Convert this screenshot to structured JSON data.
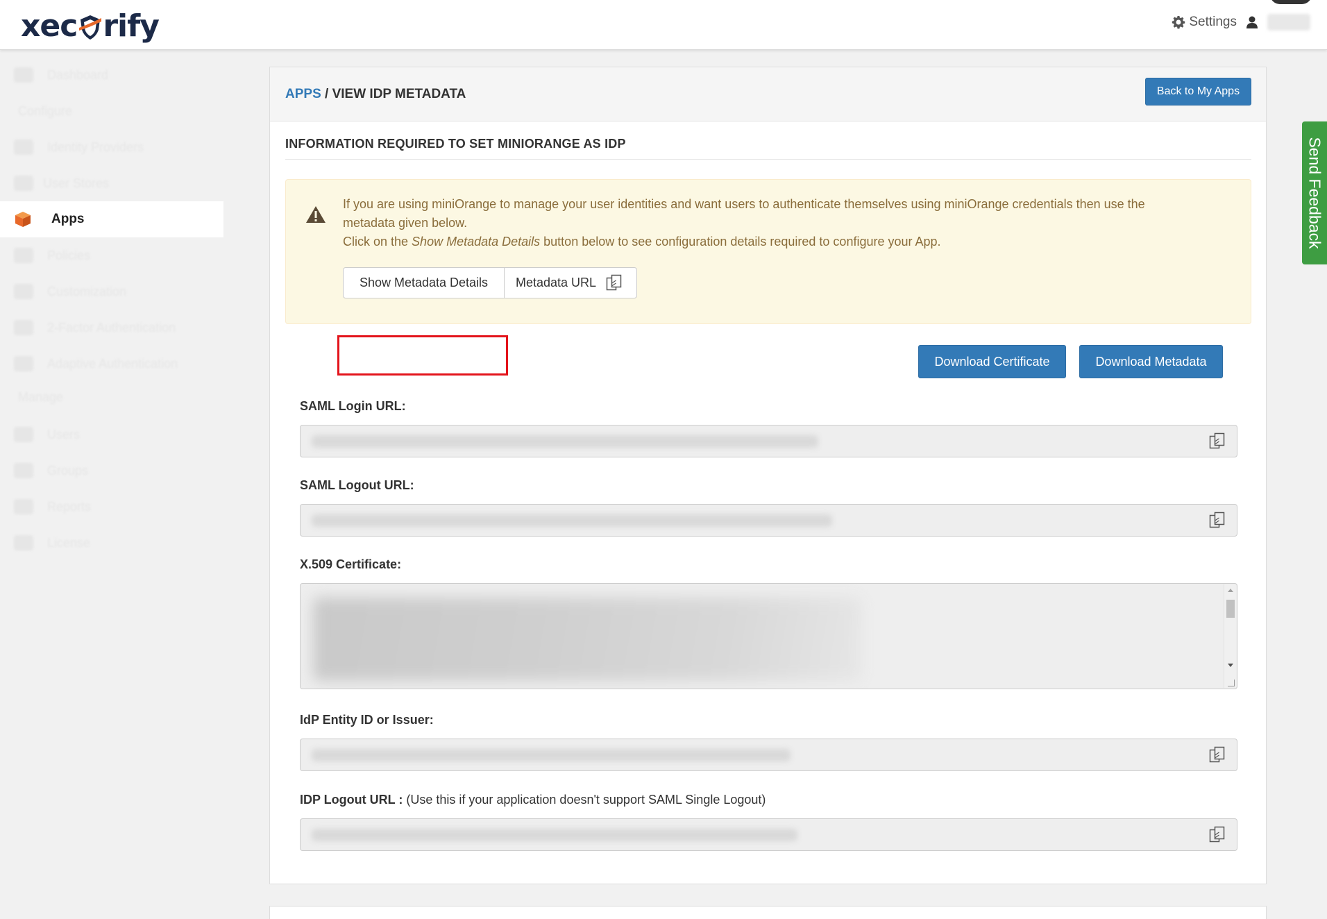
{
  "brand": {
    "logo_left": "xec",
    "logo_right": "rify"
  },
  "header": {
    "settings_label": "Settings",
    "icons": [
      "gear-icon",
      "user-icon"
    ]
  },
  "sidebar": {
    "items": [
      {
        "label": "Dashboard",
        "icon": "dashboard-icon"
      },
      {
        "label": "Configure",
        "section": true
      },
      {
        "label": "Identity Providers",
        "icon": "exchange-icon"
      },
      {
        "label": "User Stores",
        "icon": "database-icon"
      },
      {
        "label": "Apps",
        "icon": "cube-icon",
        "active": true
      },
      {
        "label": "Policies",
        "icon": "document-icon"
      },
      {
        "label": "Customization",
        "icon": "wrench-icon"
      },
      {
        "label": "2-Factor Authentication",
        "icon": "lock-icon"
      },
      {
        "label": "Adaptive Authentication",
        "icon": "shield-icon"
      },
      {
        "label": "Manage",
        "section": true
      },
      {
        "label": "Users",
        "icon": "user-icon"
      },
      {
        "label": "Groups",
        "icon": "group-icon"
      },
      {
        "label": "Reports",
        "icon": "chart-icon"
      },
      {
        "label": "License",
        "icon": "chart-icon"
      }
    ]
  },
  "breadcrumb": {
    "link": "APPS",
    "separator": " / ",
    "current": "VIEW IDP METADATA"
  },
  "back_button": "Back to My Apps",
  "section_title": "INFORMATION REQUIRED TO SET MINIORANGE AS IDP",
  "alert": {
    "line1": "If you are using miniOrange to manage your user identities and want users to authenticate themselves using miniOrange credentials then use the metadata given below.",
    "line2_prefix": "Click on the ",
    "line2_em": "Show Metadata Details",
    "line2_suffix": " button below to see configuration details required to configure your App.",
    "icon": "warning-icon"
  },
  "buttons": {
    "show_metadata": "Show Metadata Details",
    "metadata_url": "Metadata URL",
    "download_certificate": "Download Certificate",
    "download_metadata": "Download Metadata"
  },
  "fields": {
    "saml_login": {
      "label": "SAML Login URL:"
    },
    "saml_logout": {
      "label": "SAML Logout URL:"
    },
    "certificate": {
      "label": "X.509 Certificate:"
    },
    "entity_id": {
      "label": "IdP Entity ID or Issuer:"
    },
    "idp_logout": {
      "label": "IDP Logout URL :",
      "note": " (Use this if your application doesn't support SAML Single Logout)"
    }
  },
  "feedback_tab": "Send Feedback",
  "colors": {
    "primary": "#337ab7",
    "alert_bg": "#fcf8e3",
    "alert_text": "#8a6d3b",
    "highlight": "#e3141b",
    "feedback": "#3e9d42",
    "brand_orange": "#e8692a"
  }
}
